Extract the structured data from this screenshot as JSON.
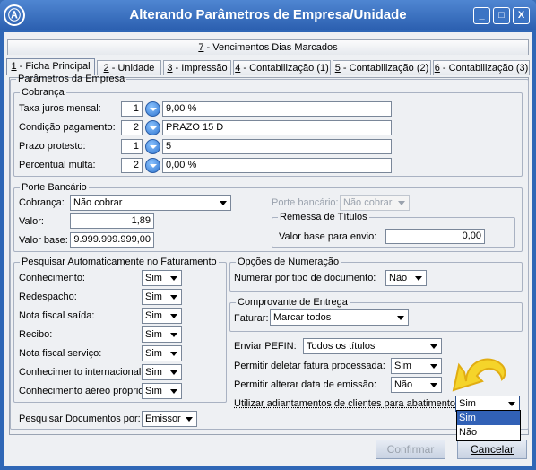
{
  "window": {
    "title": "Alterando Parâmetros de Empresa/Unidade",
    "logo": "Ⓐ",
    "controls": {
      "minimize": "_",
      "maximize": "□",
      "close": "X"
    }
  },
  "tabs_top": [
    {
      "key": "7",
      "label": " - Vencimentos Dias Marcados"
    }
  ],
  "tabs": [
    {
      "key": "1",
      "label": " - Ficha Principal"
    },
    {
      "key": "2",
      "label": " - Unidade"
    },
    {
      "key": "3",
      "label": " - Impressão"
    },
    {
      "key": "4",
      "label": " - Contabilização (1)"
    },
    {
      "key": "5",
      "label": " - Contabilização (2)"
    },
    {
      "key": "6",
      "label": " - Contabilização (3)"
    }
  ],
  "parametros": {
    "legend": "Parâmetros da Empresa",
    "cobranca": {
      "legend": "Cobrança",
      "rows": [
        {
          "label": "Taxa juros mensal:",
          "code": "1",
          "value": "9,00 %"
        },
        {
          "label": "Condição pagamento:",
          "code": "2",
          "value": "PRAZO 15 D"
        },
        {
          "label": "Prazo protesto:",
          "code": "1",
          "value": "5"
        },
        {
          "label": "Percentual multa:",
          "code": "2",
          "value": "0,00 %"
        }
      ]
    },
    "porte": {
      "legend": "Porte Bancário",
      "cobranca_label": "Cobrança:",
      "cobranca_value": "Não cobrar",
      "porte_label": "Porte bancário:",
      "porte_value": "Não cobrar",
      "valor_label": "Valor:",
      "valor_value": "1,89",
      "valor_base_label": "Valor base:",
      "valor_base_value": "9.999.999.999,00",
      "remessa": {
        "legend": "Remessa de Títulos",
        "label": "Valor base para envio:",
        "value": "0,00"
      }
    },
    "pesquisar": {
      "legend": "Pesquisar Automaticamente no Faturamento",
      "rows": [
        {
          "label": "Conhecimento:",
          "value": "Sim"
        },
        {
          "label": "Redespacho:",
          "value": "Sim"
        },
        {
          "label": "Nota fiscal saída:",
          "value": "Sim"
        },
        {
          "label": "Recibo:",
          "value": "Sim"
        },
        {
          "label": "Nota fiscal serviço:",
          "value": "Sim"
        },
        {
          "label": "Conhecimento internacional:",
          "value": "Sim"
        },
        {
          "label": "Conhecimento aéreo próprio:",
          "value": "Sim"
        }
      ]
    },
    "numeracao": {
      "legend": "Opções de Numeração",
      "label": "Numerar por tipo de documento:",
      "value": "Não"
    },
    "comprovante": {
      "legend": "Comprovante de Entrega",
      "label": "Faturar:",
      "value": "Marcar todos"
    },
    "enviar_pefin": {
      "label": "Enviar PEFIN:",
      "value": "Todos os títulos"
    },
    "deletar_fatura": {
      "label": "Permitir deletar fatura processada:",
      "value": "Sim"
    },
    "alterar_data": {
      "label": "Permitir alterar data de emissão:",
      "value": "Não"
    },
    "adiantamentos": {
      "label": "Utilizar adiantamentos de clientes para abatimento:",
      "value": "Sim",
      "options": [
        "Sim",
        "Não"
      ]
    },
    "pesquisar_docs": {
      "label": "Pesquisar Documentos por:",
      "value": "Emissor"
    }
  },
  "buttons": {
    "confirmar": "Confirmar",
    "cancelar": "Cancelar"
  },
  "colors": {
    "titlebar": "#2b5fb0",
    "highlight": "#3161b6",
    "arrow": "#f2c400"
  }
}
